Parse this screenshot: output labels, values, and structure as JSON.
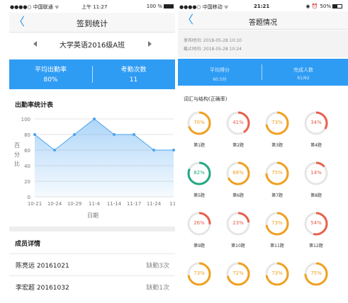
{
  "left": {
    "status": {
      "carrier": "●●●●○ 中国联通 ᯤ",
      "time": "上午 11:27",
      "battery": "100 %"
    },
    "nav": {
      "back": "〈",
      "title": "签到统计"
    },
    "class_name": "大学英语2016级A班",
    "stats": {
      "avg_label": "平均出勤率",
      "avg_value": "80%",
      "count_label": "考勤次数",
      "count_value": "11"
    },
    "chart_title": "出勤率统计表",
    "chart_data": {
      "type": "line",
      "title": "出勤率统计表",
      "xlabel": "日期",
      "ylabel": "百分比",
      "categories": [
        "10-21",
        "10-24",
        "10-29",
        "11-4",
        "11-14",
        "11-17",
        "11-24",
        "11-"
      ],
      "values": [
        80,
        60,
        80,
        100,
        80,
        80,
        60,
        60
      ],
      "ylim": [
        0,
        100
      ],
      "yticks": [
        "0",
        "20",
        "40",
        "60",
        "80",
        "100"
      ],
      "ylabel_chars": [
        "百",
        "分",
        "比"
      ],
      "color": "#4aa3f0",
      "grid": true
    },
    "members_title": "成员详情",
    "members": [
      {
        "name": "陈亮远  20161021",
        "absent": "缺勤3次"
      },
      {
        "name": "李宏超  20161032",
        "absent": "缺勤1次"
      }
    ]
  },
  "right": {
    "status": {
      "carrier": "●●●●○ 中国移动 ᯤ",
      "time": "21:21",
      "icons": "◉ ⏰",
      "battery": "50%"
    },
    "nav": {
      "back": "〈",
      "title": "答题情况"
    },
    "publish_time": "发布时间:  2018-05-28 10:10",
    "deadline_time": "截止时间:  2018-05-28 10:24",
    "score": {
      "avg_label": "平均得分",
      "avg_value": "60.5分",
      "done_label": "完成人数",
      "done_value": "61/62"
    },
    "section_title": "词汇与结构(正确率)",
    "colors": {
      "red": "#e8604c",
      "orange": "#f0a020",
      "green": "#22a884",
      "track": "#e6e6e6"
    },
    "questions": [
      {
        "label": "第1题",
        "pct": "70%",
        "value": 70,
        "color": "orange"
      },
      {
        "label": "第2题",
        "pct": "41%",
        "value": 41,
        "color": "red"
      },
      {
        "label": "第3题",
        "pct": "73%",
        "value": 73,
        "color": "orange"
      },
      {
        "label": "第4题",
        "pct": "34%",
        "value": 34,
        "color": "red"
      },
      {
        "label": "第5题",
        "pct": "82%",
        "value": 82,
        "color": "green"
      },
      {
        "label": "第6题",
        "pct": "68%",
        "value": 68,
        "color": "orange"
      },
      {
        "label": "第7题",
        "pct": "75%",
        "value": 75,
        "color": "orange"
      },
      {
        "label": "第8题",
        "pct": "14%",
        "value": 14,
        "color": "red"
      },
      {
        "label": "第9题",
        "pct": "26%",
        "value": 26,
        "color": "red"
      },
      {
        "label": "第10题",
        "pct": "23%",
        "value": 23,
        "color": "red"
      },
      {
        "label": "第11题",
        "pct": "73%",
        "value": 73,
        "color": "orange"
      },
      {
        "label": "第12题",
        "pct": "54%",
        "value": 54,
        "color": "red"
      },
      {
        "label": "",
        "pct": "73%",
        "value": 73,
        "color": "orange"
      },
      {
        "label": "",
        "pct": "72%",
        "value": 72,
        "color": "orange"
      },
      {
        "label": "",
        "pct": "73%",
        "value": 73,
        "color": "orange"
      },
      {
        "label": "",
        "pct": "75%",
        "value": 75,
        "color": "orange"
      }
    ]
  }
}
